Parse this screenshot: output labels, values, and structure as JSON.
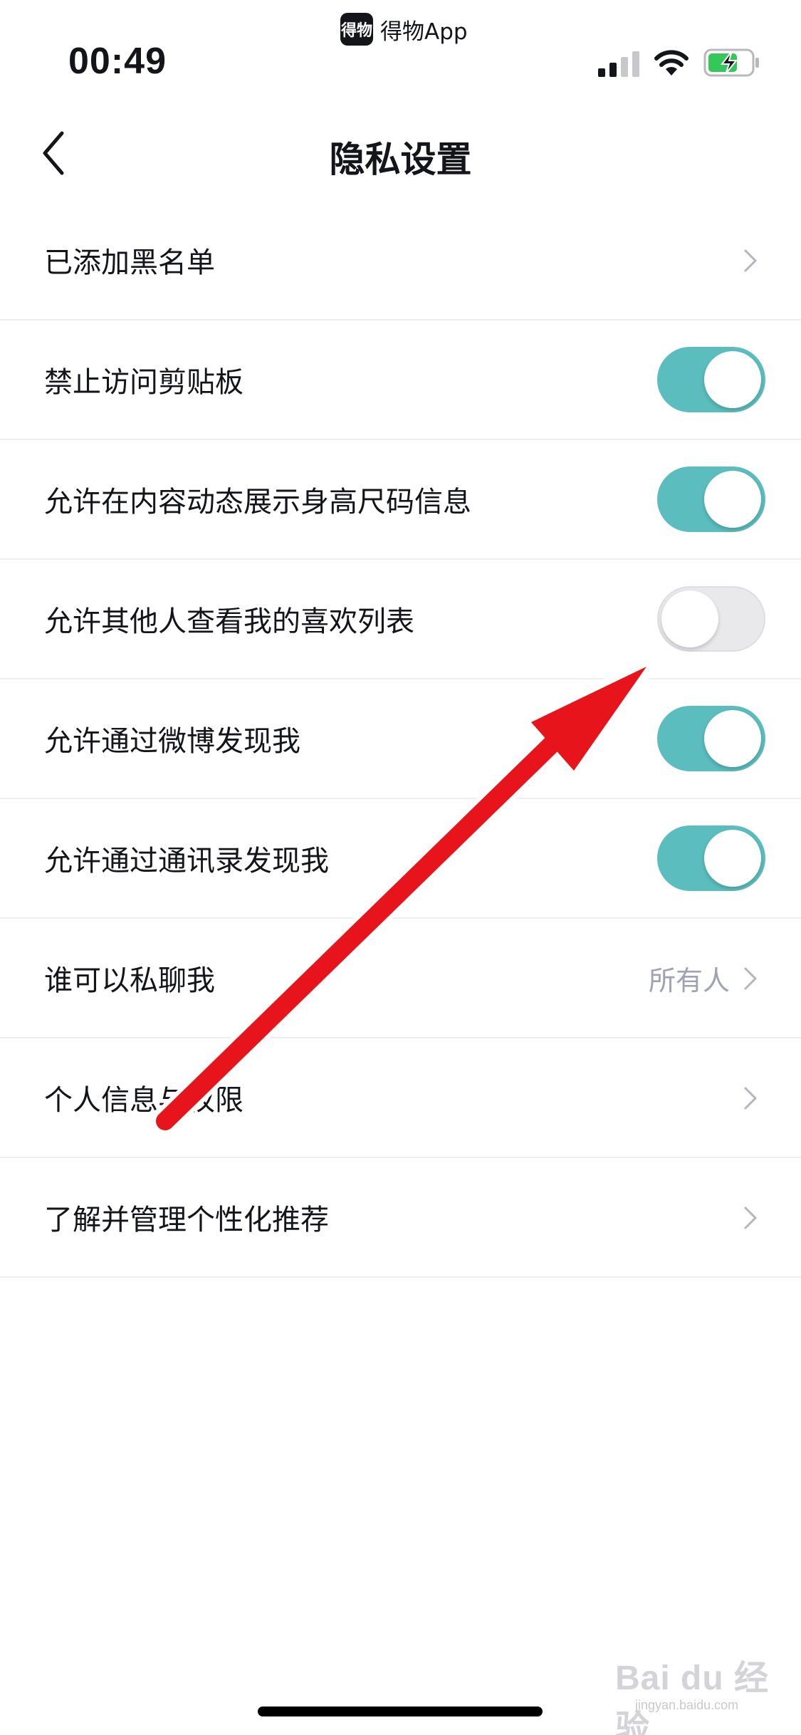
{
  "status_bar": {
    "app_badge_logo": "得物",
    "app_badge_name": "得物App",
    "time": "00:49",
    "icons": [
      "cellular-signal-icon",
      "wifi-icon",
      "battery-charging-icon"
    ],
    "battery_color": "#34c759"
  },
  "nav": {
    "back_icon": "chevron-left-icon",
    "title": "隐私设置"
  },
  "settings": [
    {
      "label": "已添加黑名单",
      "type": "link"
    },
    {
      "label": "禁止访问剪贴板",
      "type": "toggle",
      "on": true
    },
    {
      "label": "允许在内容动态展示身高尺码信息",
      "type": "toggle",
      "on": true
    },
    {
      "label": "允许其他人查看我的喜欢列表",
      "type": "toggle",
      "on": false
    },
    {
      "label": "允许通过微博发现我",
      "type": "toggle",
      "on": true
    },
    {
      "label": "允许通过通讯录发现我",
      "type": "toggle",
      "on": true
    },
    {
      "label": "谁可以私聊我",
      "type": "link",
      "value": "所有人"
    },
    {
      "label": "个人信息与权限",
      "type": "link"
    },
    {
      "label": "了解并管理个性化推荐",
      "type": "link"
    }
  ],
  "colors": {
    "toggle_on": "#5bbdbd",
    "toggle_off": "#e9e9ec",
    "annotation_arrow": "#e8141b",
    "secondary_text": "#a1a1b6"
  },
  "watermark": {
    "text": "Bai du 经验",
    "sub": "jingyan.baidu.com"
  }
}
